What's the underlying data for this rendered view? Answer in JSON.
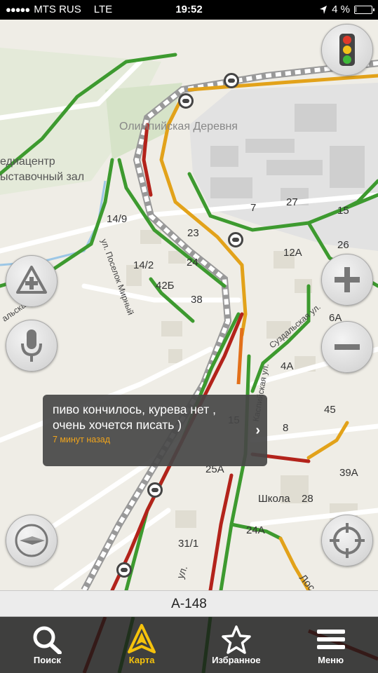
{
  "status_bar": {
    "carrier": "MTS RUS",
    "network": "LTE",
    "time": "19:52",
    "battery_percent": "4 %",
    "battery_level": 0.04
  },
  "map": {
    "place_labels": [
      "Олимпийская Деревня",
      "едиацентр",
      "ыставочный зал"
    ],
    "street_labels": [
      "ул. Поселок Мирный",
      "Каспийская ул.",
      "Суздальская ул.",
      "Лос",
      "ул.",
      "альская"
    ],
    "house_numbers": [
      "14/9",
      "7",
      "27",
      "15",
      "23",
      "26",
      "12А",
      "14/2",
      "24",
      "42Б",
      "38",
      "6А",
      "4А",
      "45",
      "15",
      "8",
      "25А",
      "39А",
      "Школа",
      "28",
      "24А",
      "31/1"
    ],
    "colors": {
      "traffic_green": "#3d9a2f",
      "traffic_yellow": "#e2a21a",
      "traffic_red": "#b3231b",
      "route": "#f5c20c"
    }
  },
  "buttons": {
    "traffic_light": "traffic-light-icon",
    "add_point": "add-point-icon",
    "voice": "microphone-icon",
    "zoom_in": "plus-icon",
    "zoom_out": "minus-icon",
    "compass": "compass-icon",
    "locate": "locate-icon"
  },
  "popup": {
    "message": "пиво кончилось, курева нет , очень хочется писать )",
    "time": "7 минут назад",
    "arrow": "›"
  },
  "street_bar": {
    "name": "А-148"
  },
  "tabs": [
    {
      "label": "Поиск",
      "icon": "search-icon",
      "active": false
    },
    {
      "label": "Карта",
      "icon": "map-arrow-icon",
      "active": true
    },
    {
      "label": "Избранное",
      "icon": "star-icon",
      "active": false
    },
    {
      "label": "Меню",
      "icon": "menu-icon",
      "active": false
    }
  ]
}
